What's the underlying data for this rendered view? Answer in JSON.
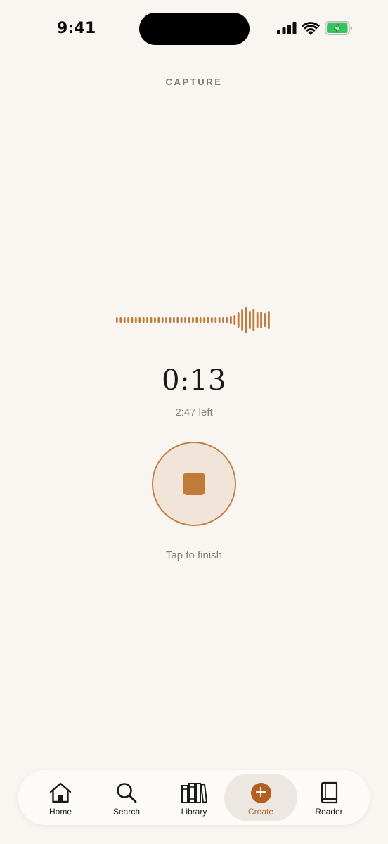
{
  "status_bar": {
    "time": "9:41"
  },
  "header": {
    "title": "CAPTURE"
  },
  "recorder": {
    "elapsed": "0:13",
    "remaining": "2:47 left",
    "hint": "Tap to finish",
    "accent_color": "#c07a3a"
  },
  "tabs": [
    {
      "label": "Home",
      "icon": "home-icon"
    },
    {
      "label": "Search",
      "icon": "search-icon"
    },
    {
      "label": "Library",
      "icon": "library-icon"
    },
    {
      "label": "Create",
      "icon": "plus-icon",
      "active": true
    },
    {
      "label": "Reader",
      "icon": "book-icon"
    }
  ]
}
